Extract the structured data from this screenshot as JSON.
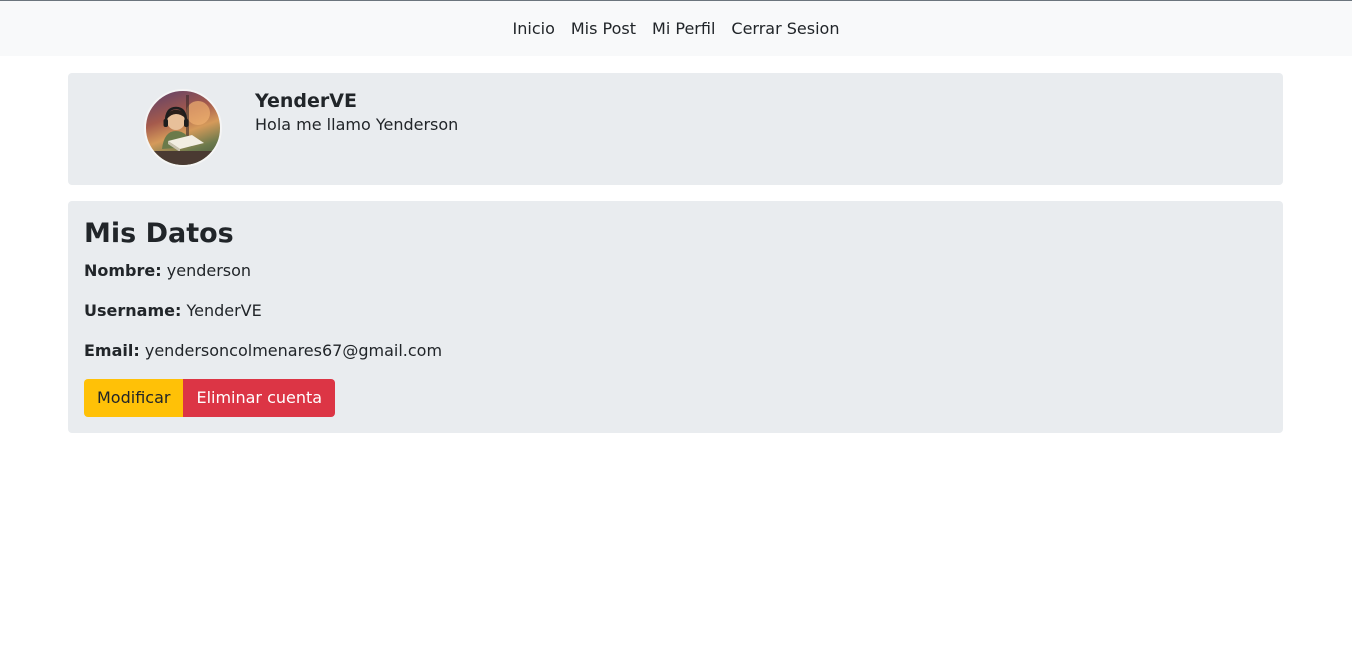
{
  "nav": {
    "items": [
      {
        "label": "Inicio"
      },
      {
        "label": "Mis Post"
      },
      {
        "label": "Mi Perfil"
      },
      {
        "label": "Cerrar Sesion"
      }
    ]
  },
  "profile": {
    "name": "YenderVE",
    "bio": "Hola me llamo Yenderson",
    "avatar_icon": "user-avatar-illustration"
  },
  "data": {
    "title": "Mis Datos",
    "fields": [
      {
        "label": "Nombre:",
        "value": "yenderson"
      },
      {
        "label": "Username:",
        "value": "YenderVE"
      },
      {
        "label": "Email:",
        "value": "yendersoncolmenares67@gmail.com"
      }
    ],
    "buttons": {
      "modify_label": "Modificar",
      "delete_label": "Eliminar cuenta"
    }
  },
  "colors": {
    "navbar_bg": "#f8f9fa",
    "card_bg": "#e9ecef",
    "warning": "#ffc107",
    "danger": "#dc3545"
  }
}
